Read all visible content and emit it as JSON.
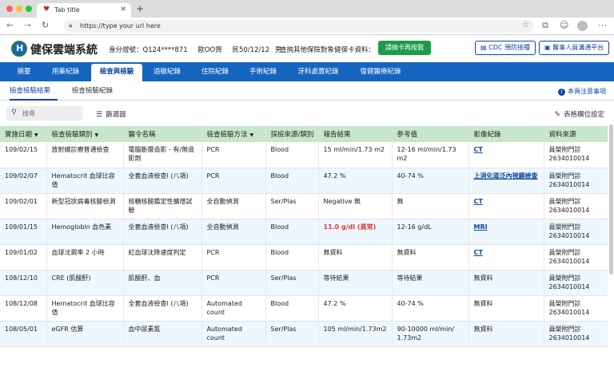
{
  "browser": {
    "tab_title": "Tab title",
    "url": "https://type your url here"
  },
  "header": {
    "app_title": "健保雲端系統",
    "id_label": "身分證號：Q124****871",
    "name": "歐OO齊",
    "birth": "民50/12/12",
    "sex": "男",
    "query_label": "查詢其他保險對象健保卡資料：",
    "insert_card_button": "請換卡再按我",
    "cdc_button": "CDC 預防接種",
    "staff_button": "醫事人員溝通平台"
  },
  "main_nav": [
    {
      "label": "摘要",
      "active": false
    },
    {
      "label": "用藥紀錄",
      "active": false
    },
    {
      "label": "檢查與檢驗",
      "active": true
    },
    {
      "label": "過敏紀錄",
      "active": false
    },
    {
      "label": "住院紀錄",
      "active": false
    },
    {
      "label": "手術紀錄",
      "active": false
    },
    {
      "label": "牙科處置紀錄",
      "active": false
    },
    {
      "label": "復健醫療紀錄",
      "active": false
    }
  ],
  "sub_nav": {
    "tabs": [
      {
        "label": "檢查檢驗結果",
        "active": true
      },
      {
        "label": "檢查檢驗紀錄",
        "active": false
      }
    ],
    "notice": "本頁注意事項"
  },
  "filters": {
    "search_placeholder": "搜尋",
    "filter_label": "篩選器",
    "column_settings_label": "表格欄位設定"
  },
  "table": {
    "columns": [
      {
        "label": "實施日期",
        "sortable": true
      },
      {
        "label": "檢查檢驗類別",
        "sortable": true
      },
      {
        "label": "醫令名稱",
        "sortable": false
      },
      {
        "label": "檢查檢驗方法",
        "sortable": true
      },
      {
        "label": "採檢來源/類別",
        "sortable": false
      },
      {
        "label": "報告結果",
        "sortable": false
      },
      {
        "label": "參考值",
        "sortable": false
      },
      {
        "label": "影像紀錄",
        "sortable": false
      },
      {
        "label": "資料來源",
        "sortable": false
      }
    ],
    "rows": [
      {
        "date": "109/02/15",
        "category": "放射線診療普通檢查",
        "order": "電腦斷層造影 - 有/無造影劑",
        "method": "PCR",
        "source": "Blood",
        "result": "15 ml/min/1.73 m2",
        "result_abnormal": false,
        "reference": "12-16 ml/min/1.73 m2",
        "image": "CT",
        "image_link": true,
        "origin": "員榮附門診 2634010014"
      },
      {
        "date": "109/02/07",
        "category": "Hematocrit 血球比容值",
        "order": "全套血液檢查I (八項)",
        "method": "PCR",
        "source": "Blood",
        "result": "47.2 %",
        "result_abnormal": false,
        "reference": "40-74 %",
        "image": "上消化道泛內視鏡檢查",
        "image_link": true,
        "origin": "員榮附門診 2634010014"
      },
      {
        "date": "109/02/01",
        "category": "新型冠狀病毒核酸檢測",
        "order": "核糖核酸鑑定性擴增試驗",
        "method": "全自動偵測",
        "source": "Ser/Plas",
        "result": "Negative 無",
        "result_abnormal": false,
        "reference": "無",
        "image": "CT",
        "image_link": true,
        "origin": "員榮附門診 2634010014"
      },
      {
        "date": "109/01/15",
        "category": "Hemoglobin 血色素",
        "order": "全套血液檢查I (八項)",
        "method": "全自動偵測",
        "source": "Blood",
        "result": "11.0 g/dl (異常)",
        "result_abnormal": true,
        "reference": "12-16 g/dL",
        "image": "MRI",
        "image_link": true,
        "origin": "員榮附門診 2634010014"
      },
      {
        "date": "109/01/02",
        "category": "血球沈澱率 2 小時",
        "order": "紅血球沈降速度判定",
        "method": "PCR",
        "source": "Blood",
        "result": "無資料",
        "result_abnormal": false,
        "reference": "無資料",
        "image": "CT",
        "image_link": true,
        "origin": "員榮附門診 2634010014"
      },
      {
        "date": "108/12/10",
        "category": "CRE (肌酸酐)",
        "order": "肌酸酐、血",
        "method": "PCR",
        "source": "Ser/Plas",
        "result": "等待結果",
        "result_abnormal": false,
        "reference": "等待結果",
        "image": "無資料",
        "image_link": false,
        "origin": "員榮附門診 2634010014"
      },
      {
        "date": "108/12/08",
        "category": "Hematocrit 血球比容值",
        "order": "全套血液檢查I (八項)",
        "method": "Automated count",
        "source": "Blood",
        "result": "47.2 %",
        "result_abnormal": false,
        "reference": "40-74 %",
        "image": "無資料",
        "image_link": false,
        "origin": "員榮附門診 2634010014"
      },
      {
        "date": "108/05/01",
        "category": "eGFR 估算",
        "order": "血中尿素氮",
        "method": "Automated count",
        "source": "Ser/Plas",
        "result": "105 ml/min/1.73m2",
        "result_abnormal": false,
        "reference": "90-10000 ml/min/ 1.73m2",
        "image": "無資料",
        "image_link": false,
        "origin": "員榮附門診 2634010014"
      }
    ]
  },
  "colors": {
    "primary": "#1565c0",
    "header_row": "#c8e6c9",
    "insert_button": "#1e9b4a",
    "abnormal": "#e53935"
  }
}
